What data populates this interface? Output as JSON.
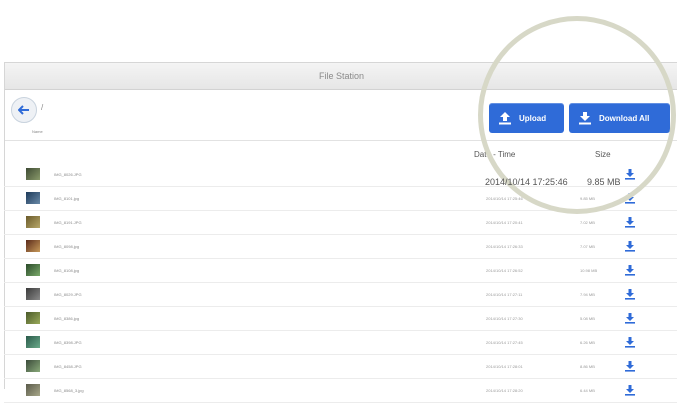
{
  "window": {
    "title": "File Station"
  },
  "pathbar": {
    "separator": "/"
  },
  "toolbar": {
    "upload_label": "Upload",
    "download_all_label": "Download All"
  },
  "columns": {
    "name": "Name",
    "datetime": "Date - Time",
    "size": "Size"
  },
  "files": [
    {
      "name": "IMG_8026.JPG",
      "datetime": "2014/10/14 17:25:46",
      "size": "9.85 MB"
    },
    {
      "name": "IMG_8101.jpg",
      "datetime": "2014/10/14 17:25:46",
      "size": "9.85 MB"
    },
    {
      "name": "IMG_8191.JPG",
      "datetime": "2014/10/14 17:20:41",
      "size": "7.02 MB"
    },
    {
      "name": "IMG_8098.jpg",
      "datetime": "2014/10/14 17:26:33",
      "size": "7.07 MB"
    },
    {
      "name": "IMG_8108.jpg",
      "datetime": "2014/10/14 17:26:52",
      "size": "10.98 MB"
    },
    {
      "name": "IMG_8029.JPG",
      "datetime": "2014/10/14 17:27:11",
      "size": "7.94 MB"
    },
    {
      "name": "IMG_8386.jpg",
      "datetime": "2014/10/14 17:27:30",
      "size": "5.08 MB"
    },
    {
      "name": "IMG_8398.JPG",
      "datetime": "2014/10/14 17:27:45",
      "size": "6.26 MB"
    },
    {
      "name": "IMG_8458.JPG",
      "datetime": "2014/10/14 17:28:01",
      "size": "8.86 MB"
    },
    {
      "name": "IMG_8568_3.jpg",
      "datetime": "2014/10/14 17:28:20",
      "size": "6.44 MB"
    }
  ],
  "colors": {
    "accent": "#2f6bd8",
    "magnifier_ring": "#d7d8c7"
  }
}
